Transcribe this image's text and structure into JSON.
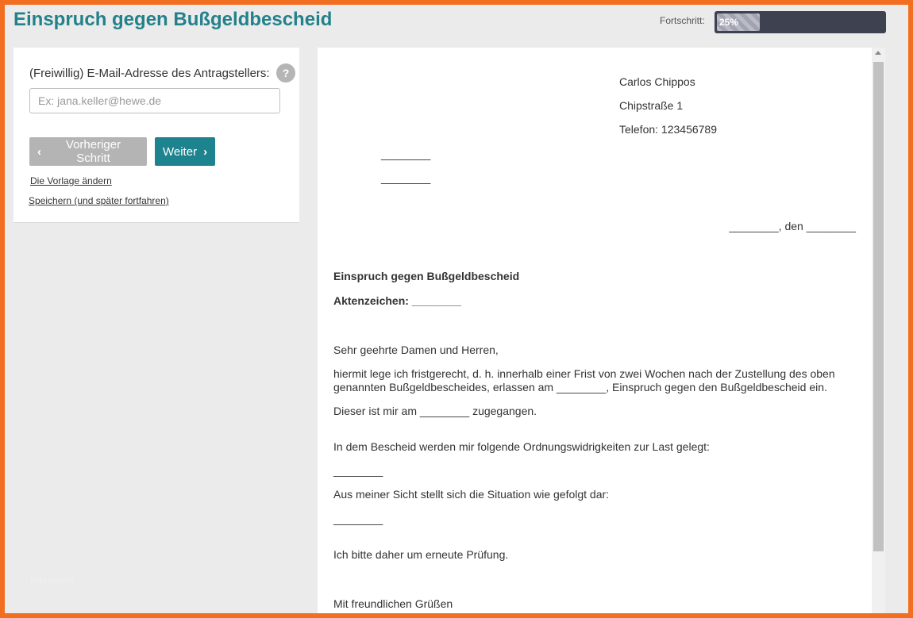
{
  "header": {
    "title": "Einspruch gegen Bußgeldbescheid",
    "progress_label": "Fortschritt:",
    "progress_text": "25%",
    "progress_value": 0.25
  },
  "form": {
    "field_label": "(Freiwillig) E-Mail-Adresse des Antragstellers:",
    "help_icon": "?",
    "email_placeholder": "Ex: jana.keller@hewe.de",
    "email_value": "",
    "prev_label": "Vorheriger Schritt",
    "next_label": "Weiter",
    "change_template": "Die Vorlage ändern",
    "save_later": "Speichern (und später fortfahren)"
  },
  "footer": {
    "text": "Impressum"
  },
  "document": {
    "sender_name": "Carlos Chippos",
    "sender_street": "Chipstraße 1",
    "sender_phone": "Telefon: 123456789",
    "recipient_line1": "________",
    "recipient_line2": "________",
    "date_line": "________, den ________",
    "subject": "Einspruch gegen Bußgeldbescheid",
    "reference": "Aktenzeichen: ________",
    "salutation": "Sehr geehrte Damen und Herren,",
    "para1_line1": "hiermit lege ich fristgerecht, d. h. innerhalb einer Frist von zwei Wochen nach der Zustellung des oben",
    "para1_line2": "genannten Bußgeldbescheides, erlassen am ________, Einspruch gegen den Bußgeldbescheid ein.",
    "para2": "Dieser ist mir am ________ zugegangen.",
    "para3": "In dem Bescheid werden mir folgende Ordnungswidrigkeiten zur Last gelegt:",
    "blank1": "________",
    "para4": "Aus meiner Sicht stellt sich die Situation wie gefolgt dar:",
    "blank2": "________",
    "para5": "Ich bitte daher um erneute Prüfung.",
    "closing": "Mit freundlichen Grüßen"
  }
}
